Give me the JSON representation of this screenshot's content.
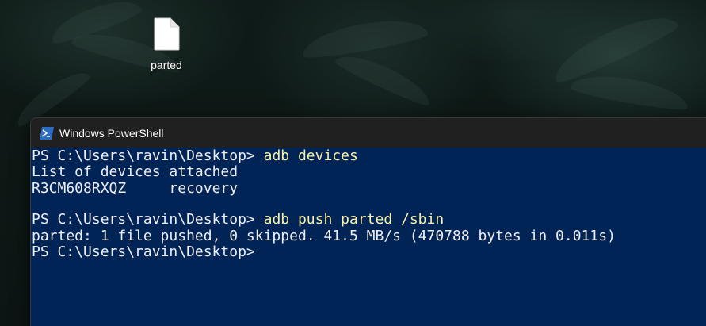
{
  "desktop": {
    "icons": [
      {
        "label": "parted",
        "icon": "file-icon"
      }
    ]
  },
  "window": {
    "title": "Windows PowerShell",
    "icon": "powershell-icon",
    "colors": {
      "titlebar": "#202020",
      "console_bg": "#012456",
      "text": "#eeedf0",
      "command": "#f9f1a5"
    }
  },
  "console": {
    "lines": [
      {
        "prompt": "PS C:\\Users\\ravin\\Desktop> ",
        "command": "adb devices",
        "output": ""
      },
      {
        "prompt": "",
        "command": "",
        "output": "List of devices attached"
      },
      {
        "prompt": "",
        "command": "",
        "output": "R3CM608RXQZ     recovery"
      },
      {
        "prompt": "",
        "command": "",
        "output": ""
      },
      {
        "prompt": "PS C:\\Users\\ravin\\Desktop> ",
        "command": "adb push parted /sbin",
        "output": ""
      },
      {
        "prompt": "",
        "command": "",
        "output": "parted: 1 file pushed, 0 skipped. 41.5 MB/s (470788 bytes in 0.011s)"
      },
      {
        "prompt": "PS C:\\Users\\ravin\\Desktop>",
        "command": "",
        "output": ""
      }
    ]
  }
}
